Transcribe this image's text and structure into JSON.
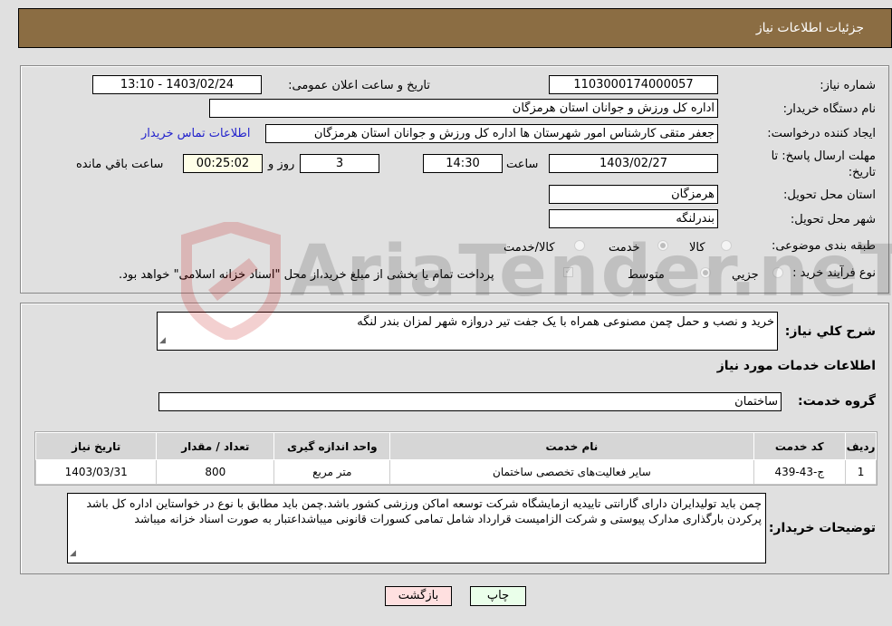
{
  "header": {
    "title": "جزئیات اطلاعات نیاز"
  },
  "fields": {
    "need_number": {
      "label": "شماره نیاز:",
      "value": "1103000174000057"
    },
    "announce_datetime": {
      "label": "تاریخ و ساعت اعلان عمومی:",
      "value": "1403/02/24 - 13:10"
    },
    "buyer_org": {
      "label": "نام دستگاه خریدار:",
      "value": "اداره کل ورزش و جوانان استان هرمزگان"
    },
    "requester": {
      "label": "ایجاد کننده درخواست:",
      "value": "جعفر متقی کارشناس امور شهرستان ها اداره کل ورزش و جوانان استان هرمزگان",
      "contact_link": "اطلاعات تماس خریدار"
    },
    "deadline": {
      "label_line1": "مهلت ارسال پاسخ: تا",
      "label_line2": "تاریخ:",
      "date": "1403/02/27",
      "time_label": "ساعت",
      "time": "14:30",
      "days": "3",
      "days_label": "روز و",
      "remaining": "00:25:02",
      "remaining_label": "ساعت باقي مانده"
    },
    "delivery_province": {
      "label": "استان محل تحویل:",
      "value": "هرمزگان"
    },
    "delivery_city": {
      "label": "شهر محل تحویل:",
      "value": "بندرلنگه"
    },
    "category": {
      "label": "طبقه بندی موضوعی:",
      "options": [
        "کالا",
        "خدمت",
        "کالا/خدمت"
      ],
      "selected": "خدمت"
    },
    "purchase_type": {
      "label": "نوع فرآیند خرید :",
      "options": [
        "جزيي",
        "متوسط"
      ],
      "selected": "متوسط",
      "note": "پرداخت تمام یا بخشی از مبلغ خرید،از محل \"اسناد خزانه اسلامی\" خواهد بود."
    }
  },
  "description": {
    "label": "شرح کلي نیاز:",
    "value": "خرید و نصب و حمل چمن مصنوعی همراه با یک جفت تیر دروازه شهر لمزان بندر لنگه"
  },
  "services_section": {
    "title": "اطلاعات خدمات مورد نیاز",
    "group_label": "گروه خدمت:",
    "group_value": "ساختمان",
    "table": {
      "columns": [
        "ردیف",
        "کد خدمت",
        "نام خدمت",
        "واحد اندازه گیری",
        "تعداد / مقدار",
        "تاریخ نیاز"
      ],
      "rows": [
        [
          "1",
          "ج-43-439",
          "سایر فعالیت‌های تخصصی ساختمان",
          "متر مربع",
          "800",
          "1403/03/31"
        ]
      ]
    }
  },
  "buyer_notes": {
    "label": "توضیحات خریدار:",
    "value": "چمن باید تولیدایران دارای گارانتی تاییدیه ازمایشگاه شرکت توسعه اماکن ورزشی کشور باشد.چمن باید مطابق با نوع در خواستاین اداره کل باشد پرکردن بارگذاری مدارک پیوستی و شرکت الزامیست قرارداد شامل تمامی کسورات قانونی میباشداعتبار به صورت اسناد خزانه میباشد"
  },
  "buttons": {
    "print": "چاپ",
    "back": "بازگشت"
  },
  "watermark": {
    "text": "AriaTender.neT"
  },
  "colors": {
    "header_bg": "#8b6d43",
    "print_bg": "#eaffea",
    "back_bg": "#ffe0e0",
    "link": "#2222cc"
  }
}
